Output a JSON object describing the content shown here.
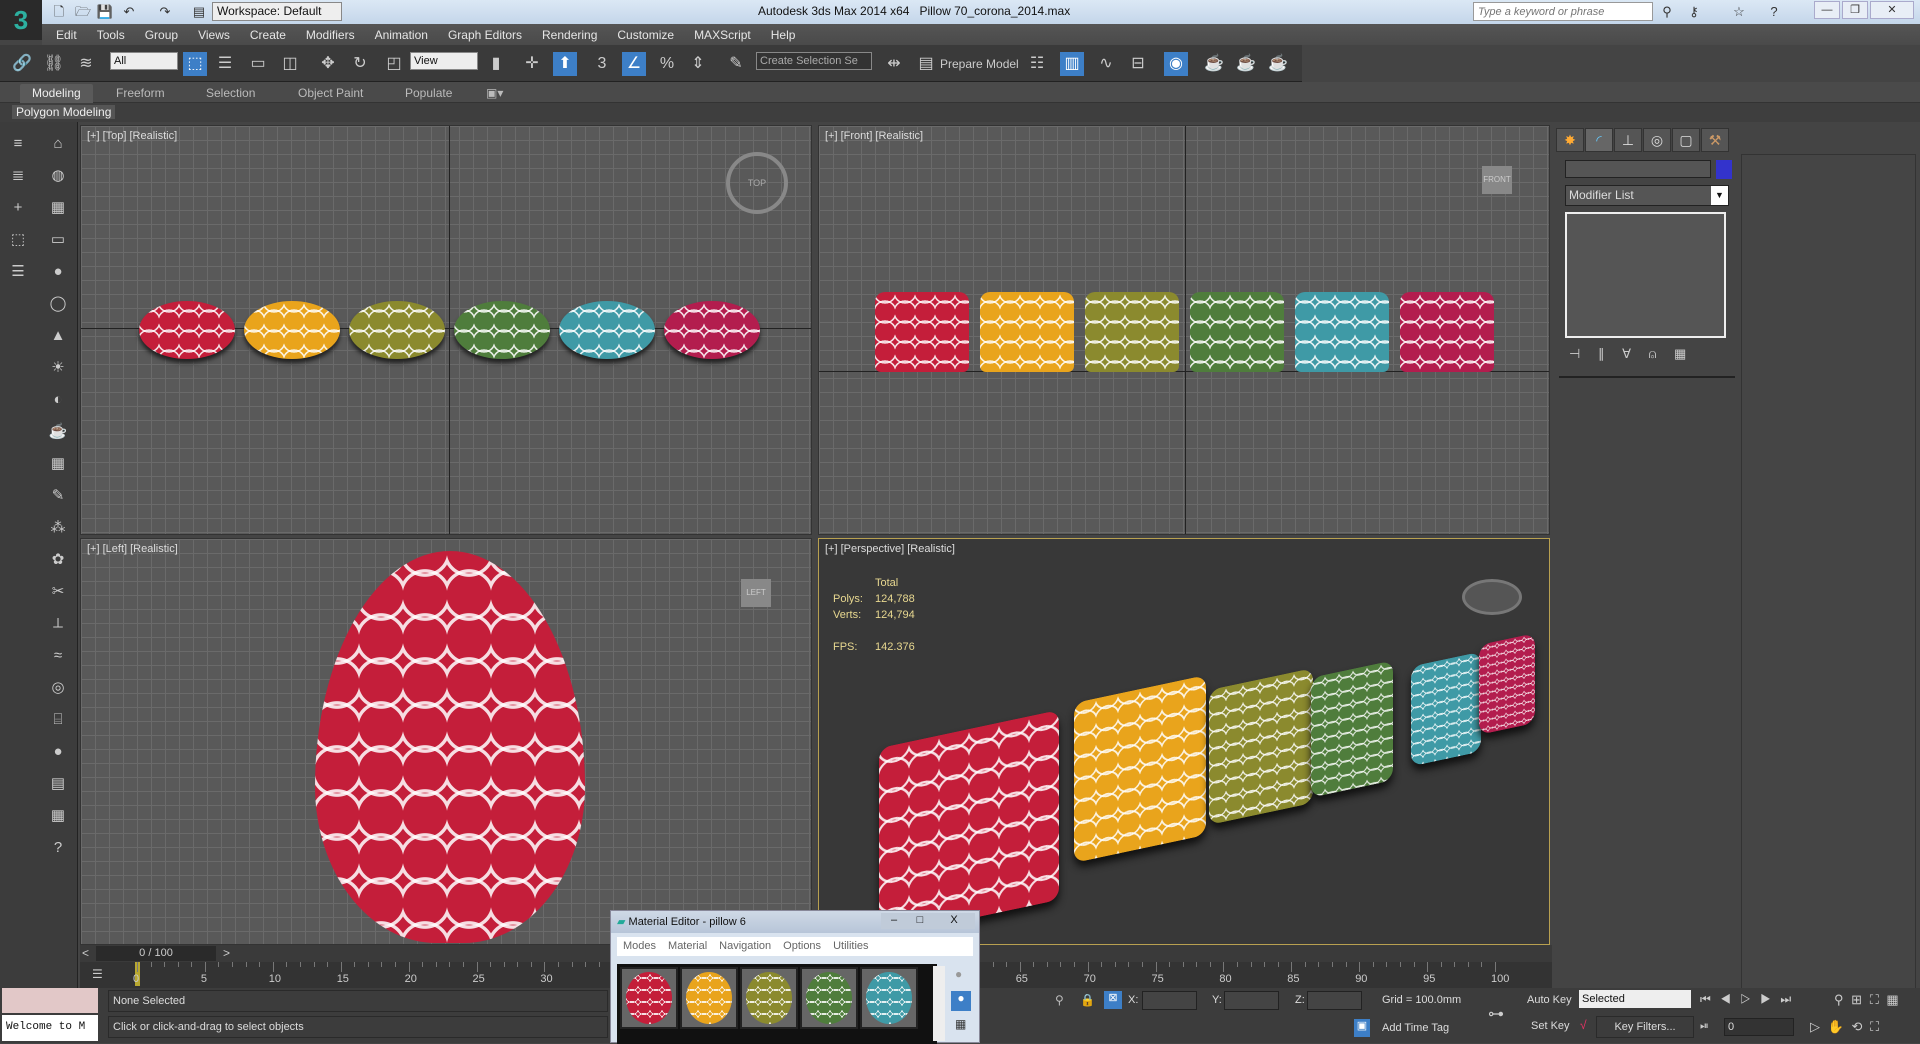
{
  "title_bar": {
    "workspace": "Workspace: Default",
    "app_title": "Autodesk 3ds Max  2014 x64",
    "file_name": "Pillow 70_corona_2014.max",
    "search_placeholder": "Type a keyword or phrase"
  },
  "menu": [
    "Edit",
    "Tools",
    "Group",
    "Views",
    "Create",
    "Modifiers",
    "Animation",
    "Graph Editors",
    "Rendering",
    "Customize",
    "MAXScript",
    "Help"
  ],
  "toolbar": {
    "selection_filter": "All",
    "ref_coord": "View",
    "named_selection": "Create Selection Se",
    "prepare_model": "Prepare Model"
  },
  "ribbon": {
    "tabs": [
      "Modeling",
      "Freeform",
      "Selection",
      "Object Paint",
      "Populate"
    ],
    "panel": "Polygon Modeling"
  },
  "viewports": {
    "top": "[+] [Top] [Realistic]",
    "front": "[+] [Front] [Realistic]",
    "left": "[+] [Left] [Realistic]",
    "perspective": "[+] [Perspective] [Realistic]",
    "stats": {
      "header": "Total",
      "polys_label": "Polys:",
      "polys": "124,788",
      "verts_label": "Verts:",
      "verts": "124,794",
      "fps_label": "FPS:",
      "fps": "142.376"
    },
    "viewcube": {
      "top": "TOP",
      "front": "FRONT",
      "left": "LEFT"
    }
  },
  "pillow_colors": [
    "#c41e3a",
    "#e9a41c",
    "#8b8a2e",
    "#4f7d3c",
    "#3f9aa6",
    "#b31d4e"
  ],
  "command_panel": {
    "modifier_list": "Modifier List",
    "color_swatch": "#3333cc"
  },
  "timeline": {
    "frame": "0 / 100",
    "ticks": [
      "0",
      "5",
      "10",
      "15",
      "20",
      "25",
      "30",
      "65",
      "70",
      "75",
      "80",
      "85",
      "90",
      "95",
      "100"
    ]
  },
  "status": {
    "selection": "None Selected",
    "prompt": "Click or click-and-drag to select objects",
    "maxscript": "Welcome to M",
    "x_label": "X:",
    "y_label": "Y:",
    "z_label": "Z:",
    "grid": "Grid = 100.0mm",
    "add_time_tag": "Add Time Tag",
    "auto_key": "Auto Key",
    "set_key": "Set Key",
    "key_mode": "Selected",
    "key_filters": "Key Filters...",
    "current_frame": "0"
  },
  "material_editor": {
    "title": "Material Editor - pillow 6",
    "menus": [
      "Modes",
      "Material",
      "Navigation",
      "Options",
      "Utilities"
    ]
  }
}
